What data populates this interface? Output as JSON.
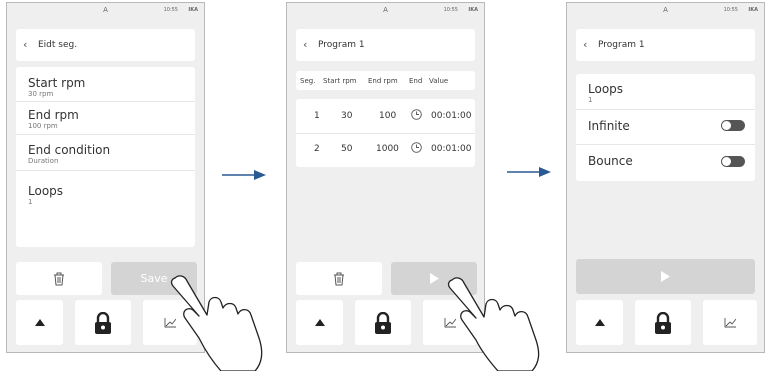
{
  "status": {
    "title": "A",
    "time": "10:55",
    "logo": "IKA"
  },
  "screen1": {
    "header": "Eidt seg.",
    "rows": [
      {
        "title": "Start rpm",
        "sub": "30 rpm"
      },
      {
        "title": "End rpm",
        "sub": "100 rpm"
      },
      {
        "title": "End condition",
        "sub": "Duration"
      }
    ],
    "loops": {
      "title": "Loops",
      "sub": "1"
    },
    "save_label": "Save"
  },
  "screen2": {
    "header": "Program 1",
    "columns": [
      "Seg.",
      "Start rpm",
      "End rpm",
      "End",
      "Value"
    ],
    "rows": [
      {
        "seg": "1",
        "start": "30",
        "end": "100",
        "value": "00:01:00"
      },
      {
        "seg": "2",
        "start": "50",
        "end": "1000",
        "value": "00:01:00"
      }
    ]
  },
  "screen3": {
    "header": "Program 1",
    "loops": {
      "title": "Loops",
      "sub": "1"
    },
    "infinite_label": "Infinite",
    "bounce_label": "Bounce"
  },
  "icons": [
    "back-chevron-icon",
    "trash-icon",
    "play-icon",
    "home-icon",
    "lock-icon",
    "chart-icon",
    "arrow-right-icon",
    "hand-pointer-icon"
  ],
  "colors": {
    "screen_bg": "#efefef",
    "card": "#ffffff",
    "disabled_button": "#d4d4d4",
    "arrow": "#2a5a93"
  }
}
